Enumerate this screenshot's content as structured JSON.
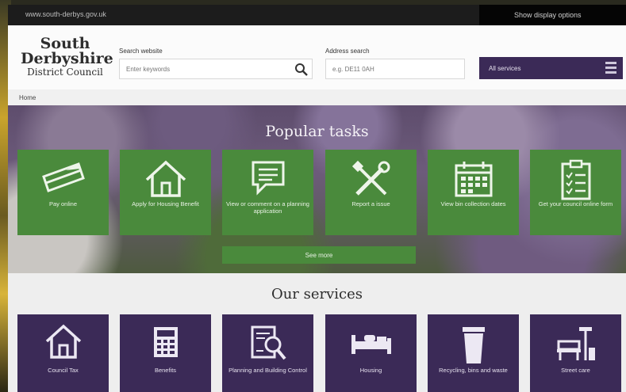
{
  "topbar": {
    "url": "www.south-derbys.gov.uk",
    "display_options": "Show display options"
  },
  "logo": {
    "line1": "South",
    "line2": "Derbyshire",
    "line3": "District Council"
  },
  "search": {
    "label": "Search website",
    "placeholder": "Enter keywords"
  },
  "address": {
    "label": "Address search",
    "placeholder": "e.g. DE11 0AH"
  },
  "all_services": {
    "label": "All services"
  },
  "breadcrumb": {
    "home": "Home"
  },
  "hero": {
    "title": "Popular tasks",
    "tasks": [
      {
        "label": "Pay online",
        "icon": "payment-card-icon"
      },
      {
        "label": "Apply for Housing Benefit",
        "icon": "house-icon"
      },
      {
        "label": "View or comment on a planning application",
        "icon": "comment-icon"
      },
      {
        "label": "Report a issue",
        "icon": "tools-icon"
      },
      {
        "label": "View bin collection dates",
        "icon": "calendar-icon"
      },
      {
        "label": "Get your council online form",
        "icon": "checklist-icon"
      }
    ],
    "see_more": "See more"
  },
  "services": {
    "title": "Our services",
    "items": [
      {
        "label": "Council Tax",
        "icon": "house-icon"
      },
      {
        "label": "Benefits",
        "icon": "calculator-icon"
      },
      {
        "label": "Planning and Building Control",
        "icon": "document-search-icon"
      },
      {
        "label": "Housing",
        "icon": "bed-icon"
      },
      {
        "label": "Recycling, bins and waste",
        "icon": "bin-icon"
      },
      {
        "label": "Street care",
        "icon": "bench-icon"
      }
    ]
  },
  "colors": {
    "purple": "#3b2a57",
    "green": "#4a8a3c",
    "topbar": "#1c1c1c"
  }
}
